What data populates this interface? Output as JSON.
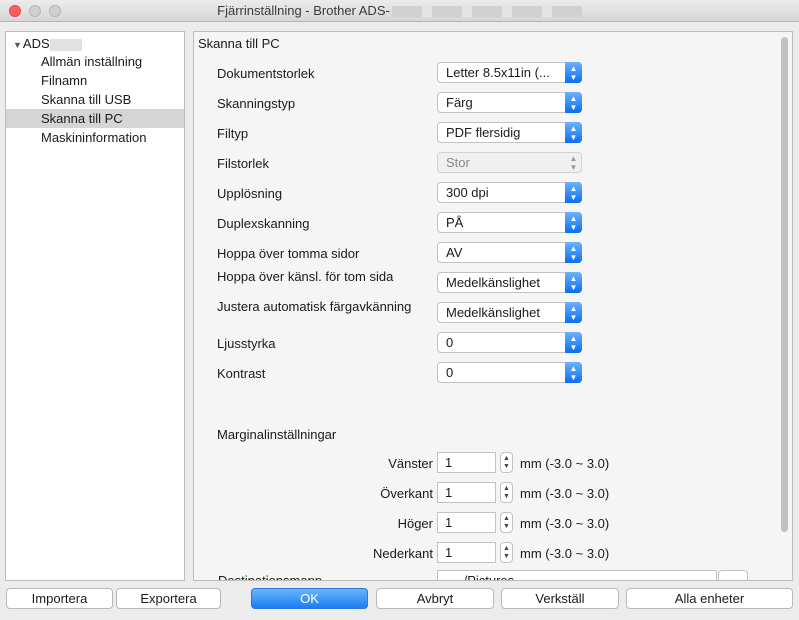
{
  "window": {
    "title": "Fjärrinställning - Brother ADS-"
  },
  "sidebar": {
    "root": "ADS",
    "items": [
      "Allmän inställning",
      "Filnamn",
      "Skanna till USB",
      "Skanna till PC",
      "Maskininformation"
    ]
  },
  "panel": {
    "title": "Skanna till PC",
    "settings": [
      {
        "label": "Dokumentstorlek",
        "value": "Letter 8.5x11in (..."
      },
      {
        "label": "Skanningstyp",
        "value": "Färg"
      },
      {
        "label": "Filtyp",
        "value": "PDF flersidig"
      },
      {
        "label": "Filstorlek",
        "value": "Stor"
      },
      {
        "label": "Upplösning",
        "value": "300 dpi"
      },
      {
        "label": "Duplexskanning",
        "value": "PÅ"
      },
      {
        "label": "Hoppa över tomma sidor",
        "value": "AV"
      },
      {
        "label": "Hoppa över känsl. för tom sida",
        "value": "Medelkänslighet"
      },
      {
        "label": "Justera automatisk färgavkänning",
        "value": "Medelkänslighet"
      },
      {
        "label": "Ljusstyrka",
        "value": "0"
      },
      {
        "label": "Kontrast",
        "value": "0"
      }
    ],
    "margin_title": "Marginalinställningar",
    "margins": [
      {
        "label": "Vänster",
        "value": "1",
        "range": "mm (-3.0 ~ 3.0)"
      },
      {
        "label": "Överkant",
        "value": "1",
        "range": "mm (-3.0 ~ 3.0)"
      },
      {
        "label": "Höger",
        "value": "1",
        "range": "mm (-3.0 ~ 3.0)"
      },
      {
        "label": "Nederkant",
        "value": "1",
        "range": "mm (-3.0 ~ 3.0)"
      }
    ],
    "destination": {
      "label": "Destinationsmapp",
      "value": "~/Pictures",
      "browse": "..."
    }
  },
  "buttons": {
    "import": "Importera",
    "export": "Exportera",
    "ok": "OK",
    "cancel": "Avbryt",
    "apply": "Verkställ",
    "all_units": "Alla enheter"
  }
}
